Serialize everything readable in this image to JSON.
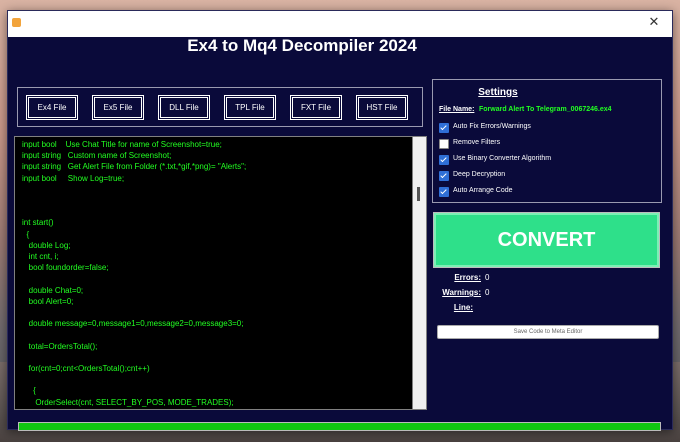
{
  "window": {
    "title": "Ex4 to Mq4 Decompiler 2024"
  },
  "titlebar": {
    "close_glyph": "✕",
    "app_icon": "app-icon"
  },
  "file_buttons": [
    {
      "label": "Ex4 File"
    },
    {
      "label": "Ex5 File"
    },
    {
      "label": "DLL File"
    },
    {
      "label": "TPL File"
    },
    {
      "label": "FXT File"
    },
    {
      "label": "HST File"
    }
  ],
  "code": {
    "lines": [
      "input bool    Use Chat Title for name of Screenshot=true;",
      "input string   Custom name of Screenshot;",
      "input string   Get Alert File from Folder (*.txt,*gif,*png)= \"Alerts\";",
      "input bool     Show Log=true;",
      "",
      "",
      "",
      "int start()",
      "  {",
      "   double Log;",
      "   int cnt, i;",
      "   bool foundorder=false;",
      "",
      "   double Chat=0;",
      "   bool Alert=0;",
      "",
      "   double message=0,message1=0,message2=0,message3=0;",
      "",
      "   total=OrdersTotal();",
      "",
      "   for(cnt=0;cnt<OrdersTotal();cnt++)",
      "",
      "     {",
      "      OrderSelect(cnt, SELECT_BY_POS, MODE_TRADES);"
    ]
  },
  "settings": {
    "title": "Settings",
    "file_name_label": "File Name:",
    "file_name_value": "Forward Alert To Telegram_0067246.ex4",
    "options": [
      {
        "label": "Auto Fix Errors/Warnings",
        "checked": true
      },
      {
        "label": "Remove Filters",
        "checked": false
      },
      {
        "label": "Use Binary Converter Algorithm",
        "checked": true
      },
      {
        "label": "Deep Decryption",
        "checked": true
      },
      {
        "label": "Auto Arrange Code",
        "checked": true
      }
    ]
  },
  "convert": {
    "label": "CONVERT"
  },
  "stats": {
    "errors_label": "Errors:",
    "errors_value": "0",
    "warnings_label": "Warnings:",
    "warnings_value": "0",
    "line_label": "Line:",
    "line_value": ""
  },
  "save": {
    "label": "Save Code to Meta Editor"
  },
  "progress": {
    "percent": 100
  },
  "colors": {
    "window_bg": "#0a0a3a",
    "code_text": "#22ff22",
    "convert_bg": "#2ee08a",
    "progress_fill": "#11c611"
  }
}
